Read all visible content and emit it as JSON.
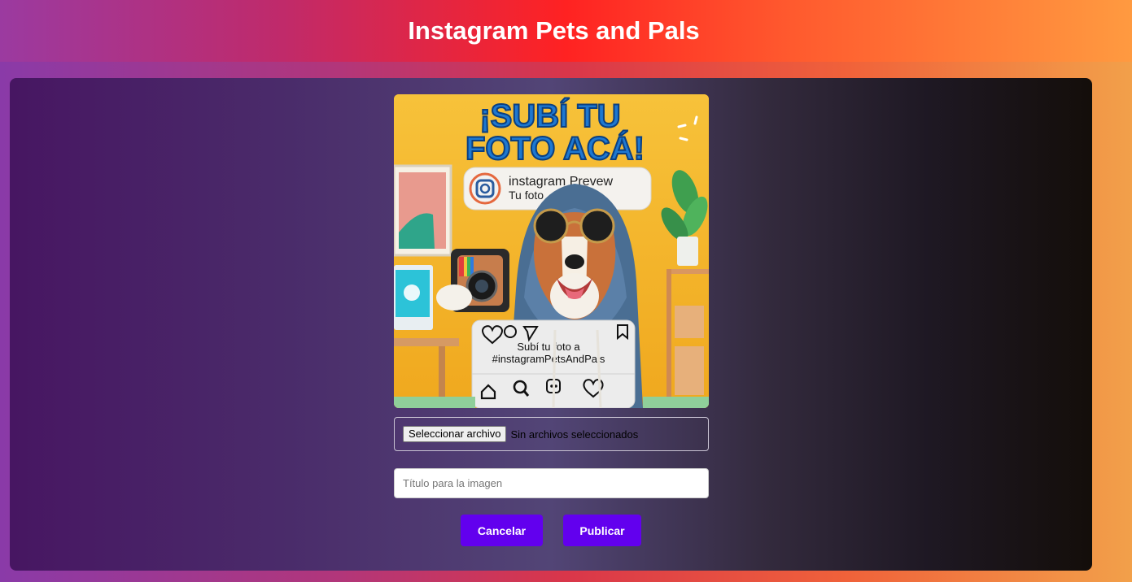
{
  "header": {
    "title": "Instagram Pets and Pals"
  },
  "preview": {
    "headline_line1": "¡SUBÍ TU",
    "headline_line2": "FOTO ACÁ!",
    "card_title": "instagram Prevew",
    "card_subtitle": "Tu foto",
    "post_caption_line1": "Subí tu foto a",
    "post_caption_line2": "#instagramPetsAndPals"
  },
  "upload": {
    "button_label": "Seleccionar archivo",
    "status": "Sin archivos seleccionados"
  },
  "title_field": {
    "placeholder": "Título para la imagen",
    "value": ""
  },
  "actions": {
    "cancel_label": "Cancelar",
    "publish_label": "Publicar"
  },
  "colors": {
    "accent": "#6200ee",
    "preview_bg": "#f5b82a"
  }
}
